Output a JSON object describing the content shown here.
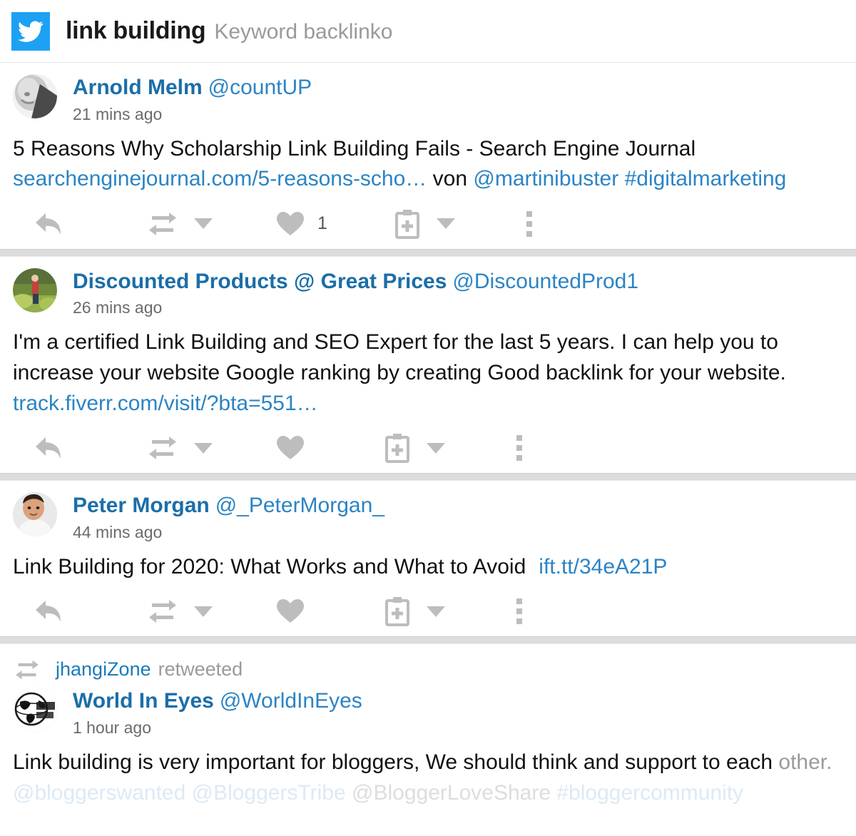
{
  "header": {
    "icon": "twitter-bird-icon",
    "title": "link building",
    "subtitle": "Keyword backlinko",
    "accent_color": "#1da1f2"
  },
  "actions": {
    "reply": "reply-icon",
    "retweet": "retweet-icon",
    "retweet_caret": "chevron-down-icon",
    "like": "heart-icon",
    "add_to_collection": "clipboard-plus-icon",
    "add_caret": "chevron-down-icon",
    "more": "more-vertical-icon"
  },
  "tweets": [
    {
      "author": "Arnold Melm",
      "handle": "@countUP",
      "time": "21 mins ago",
      "avatar": "grayscale-face-photo",
      "body_plain": "5 Reasons Why Scholarship Link Building Fails - Search Engine Journal",
      "body_link": "searchenginejournal.com/5-reasons-scho…",
      "body_mid": "von",
      "body_mention": "@martinibuster",
      "body_hashtag": "#digitalmarketing",
      "like_count": "1"
    },
    {
      "author": "Discounted Products @ Great Prices",
      "handle": "@DiscountedProd1",
      "time": "26 mins ago",
      "avatar": "outdoor-nature-photo",
      "body_plain": "I'm a certified Link Building and SEO Expert for the last 5 years. I can help you to increase your website Google ranking by creating Good backlink for your website.",
      "body_link": "track.fiverr.com/visit/?bta=551…",
      "like_count": ""
    },
    {
      "author": "Peter Morgan",
      "handle": "@_PeterMorgan_",
      "time": "44 mins ago",
      "avatar": "man-in-white-shirt-photo",
      "body_plain": "Link Building for 2020: What Works and What to Avoid",
      "body_link": "ift.tt/34eA21P",
      "like_count": ""
    },
    {
      "retweeted_by": "jhangiZone",
      "retweeted_label": "retweeted",
      "author": "World In Eyes",
      "handle": "@WorldInEyes",
      "time": "1 hour ago",
      "avatar": "globe-logo",
      "body_plain": "Link building is very important for bloggers, We should think and support to each",
      "body_plain_2": "other.",
      "body_mentions": "@bloggerswanted @BloggersTribe",
      "body_mentions_2": "@BloggerLoveShare",
      "body_hashtag": "#bloggercommunity",
      "like_count": ""
    }
  ]
}
